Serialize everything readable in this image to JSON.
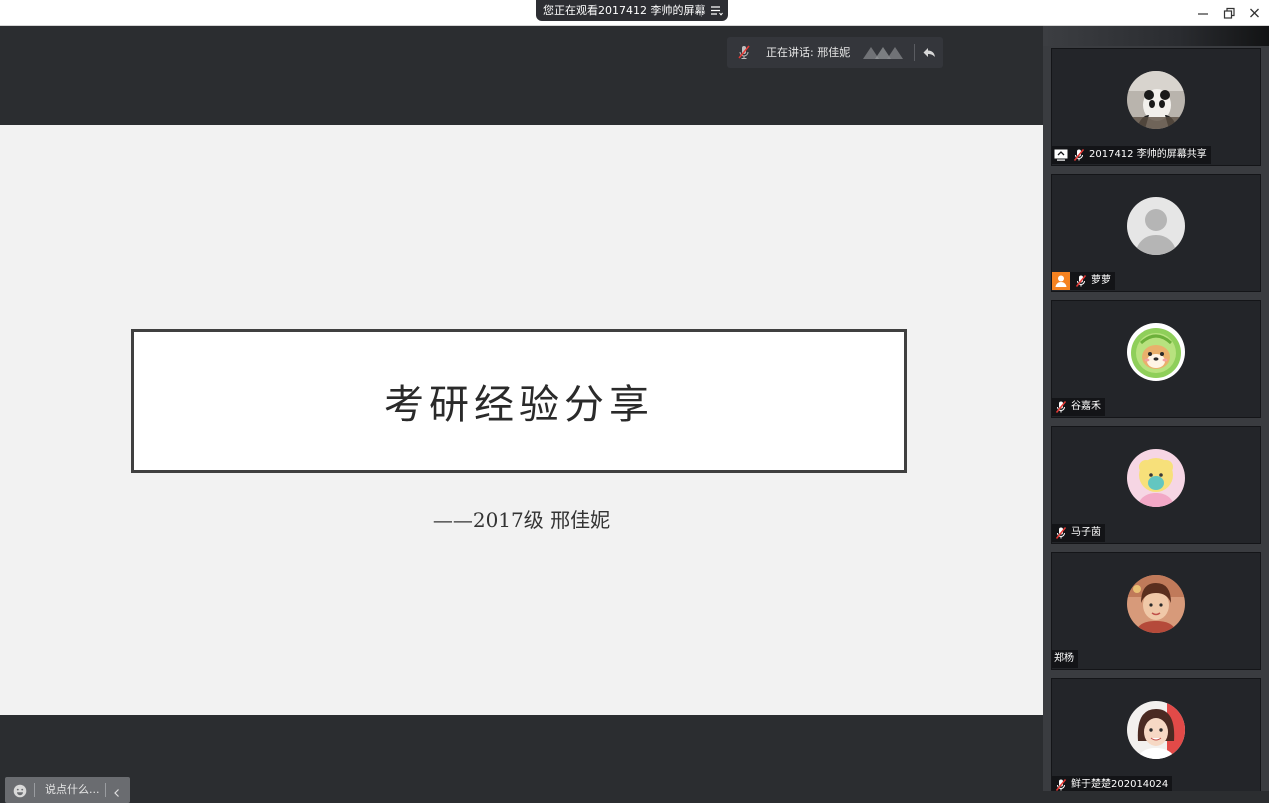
{
  "titlebar": {
    "share_notice": "您正在观看2017412 李帅的屏幕",
    "menu_icon": "list-menu-icon",
    "controls": [
      "minimize-icon",
      "restore-icon",
      "close-icon"
    ]
  },
  "speaking": {
    "label": "正在讲话: 邢佳妮",
    "mic_icon": "mic-muted-icon",
    "back_icon": "return-arrow-icon"
  },
  "slide": {
    "title": "考研经验分享",
    "subtitle": "——2017级 邢佳妮"
  },
  "chat": {
    "placeholder": "说点什么...",
    "emoji_icon": "emoji-icon",
    "collapse_icon": "chevron-left-icon"
  },
  "participants": [
    {
      "name": "2017412 李帅的屏幕共享",
      "badge": "screen-share-icon",
      "muted": true,
      "avatar": "panda-photo"
    },
    {
      "name": "萝萝",
      "badge": "host-icon",
      "muted": true,
      "avatar": "default-person"
    },
    {
      "name": "谷嘉禾",
      "badge": "",
      "muted": true,
      "avatar": "cartoon-dog-cabbage"
    },
    {
      "name": "马子茵",
      "badge": "",
      "muted": true,
      "avatar": "pink-plush-toy"
    },
    {
      "name": "郑杨",
      "badge": "",
      "muted": false,
      "avatar": "portrait-photo"
    },
    {
      "name": "鲜于楚楚202014024",
      "badge": "",
      "muted": true,
      "avatar": "girl-photo"
    }
  ],
  "colors": {
    "share_pill_bg": "#2d2e33",
    "main_bg": "#2b2d30",
    "slide_bg": "#f2f2f2",
    "mute_red": "#e53935",
    "host_orange": "#f58220"
  }
}
